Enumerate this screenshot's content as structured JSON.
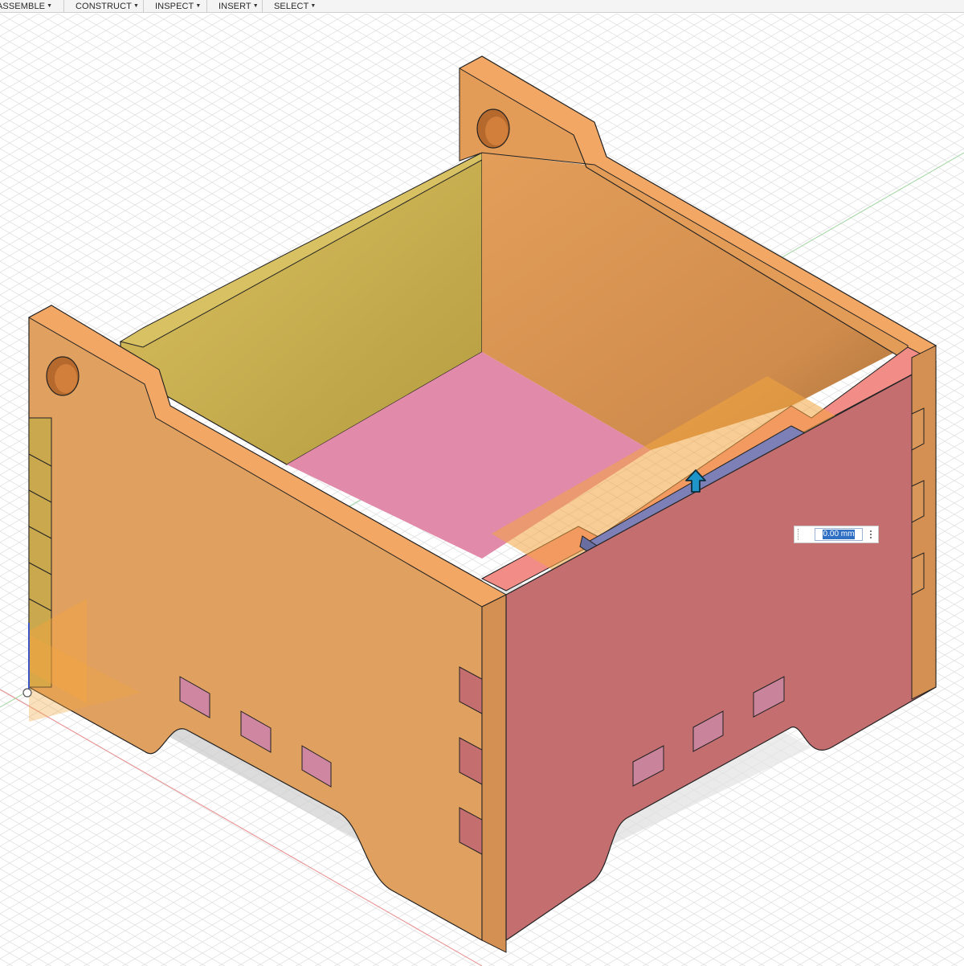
{
  "toolbar": {
    "menus": [
      {
        "label": "ASSEMBLE"
      },
      {
        "label": "CONSTRUCT"
      },
      {
        "label": "INSPECT"
      },
      {
        "label": "INSERT"
      },
      {
        "label": "SELECT"
      }
    ]
  },
  "dimension_input": {
    "value": "0.00 mm"
  },
  "icons": {
    "drag_handle": "arrow-up-icon",
    "origin": "origin-icon",
    "options": "vertical-dots-icon"
  },
  "colors": {
    "front_panel": "#dfa060",
    "right_panel": "#c46e70",
    "back_wall": "#c4a84a",
    "floor": "#e28aaa",
    "selected_face": "#7d80b6",
    "offset_plane": "#f3a540",
    "handle": "#1f94c8"
  }
}
